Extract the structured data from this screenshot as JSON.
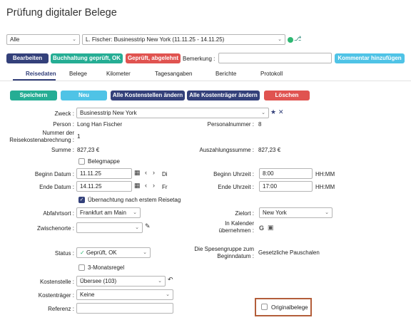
{
  "page_title": "Prüfung digitaler Belege",
  "filter": {
    "value": "Alle"
  },
  "trip": {
    "value": "L. Fischer: Businesstrip New York (11.11.25 - 14.11.25)"
  },
  "toolbar": {
    "edit": "Bearbeiten",
    "approve": "Buchhaltung geprüft, OK",
    "reject": "Geprüft, abgelehnt",
    "remark_label": "Bemerkung :",
    "remark_value": "",
    "add_comment": "Kommentar hinzufügen"
  },
  "tabs": [
    "Reisedaten",
    "Belege",
    "Kilometer",
    "Tagesangaben",
    "Berichte",
    "Protokoll"
  ],
  "actions": {
    "save": "Speichern",
    "new": "Neu",
    "change_cost_centers": "Alle Kostenstellen ändern",
    "change_cost_bearers": "Alle Kostenträger ändern",
    "delete": "Löschen"
  },
  "form": {
    "purpose_label": "Zweck :",
    "purpose_value": "Businesstrip New York",
    "person_label": "Person :",
    "person_value": "Long Han Fischer",
    "personnel_no_label": "Personalnummer :",
    "personnel_no_value": "8",
    "expense_no_label_1": "Nummer der",
    "expense_no_label_2": "Reisekostenabrechnung :",
    "expense_no_value": "1",
    "sum_label": "Summe :",
    "sum_value": "827,23 €",
    "payout_label": "Auszahlungssumme :",
    "payout_value": "827,23 €",
    "receipt_folder": "Belegmappe",
    "start_date_label": "Beginn Datum :",
    "start_date_value": "11.11.25",
    "start_weekday": "Di",
    "end_date_label": "Ende Datum :",
    "end_date_value": "14.11.25",
    "end_weekday": "Fr",
    "start_time_label": "Beginn Uhrzeit :",
    "start_time_value": "8:00",
    "end_time_label": "Ende Uhrzeit :",
    "end_time_value": "17:00",
    "time_format": "HH:MM",
    "overnight": "Übernachtung nach erstem Reisetag",
    "departure_label": "Abfahrtsort :",
    "departure_value": "Frankfurt am Main",
    "destination_label": "Zielort :",
    "destination_value": "New York",
    "stopovers_label": "Zwischenorte :",
    "stopovers_value": "",
    "calendar_label_1": "In Kalender",
    "calendar_label_2": "übernehmen :",
    "status_label": "Status :",
    "status_value": "Geprüft, OK",
    "expense_group_label_1": "Die Spesengruppe zum",
    "expense_group_label_2": "Beginndatum :",
    "expense_group_value": "Gesetzliche Pauschalen",
    "three_month_rule": "3-Monatsregel",
    "cost_center_label": "Kostenstelle :",
    "cost_center_value": "Übersee (103)",
    "cost_bearer_label": "Kostenträger :",
    "cost_bearer_value": "Keine",
    "reference_label": "Referenz :",
    "reference_value": "",
    "original_receipts": "Originalbelege"
  },
  "colors": {
    "navy": "#33407a",
    "teal": "#25ad94",
    "red": "#e05350",
    "cyan": "#4fc3e6",
    "status_dot": "#2eb872",
    "highlight_frame": "#b35e3a"
  }
}
